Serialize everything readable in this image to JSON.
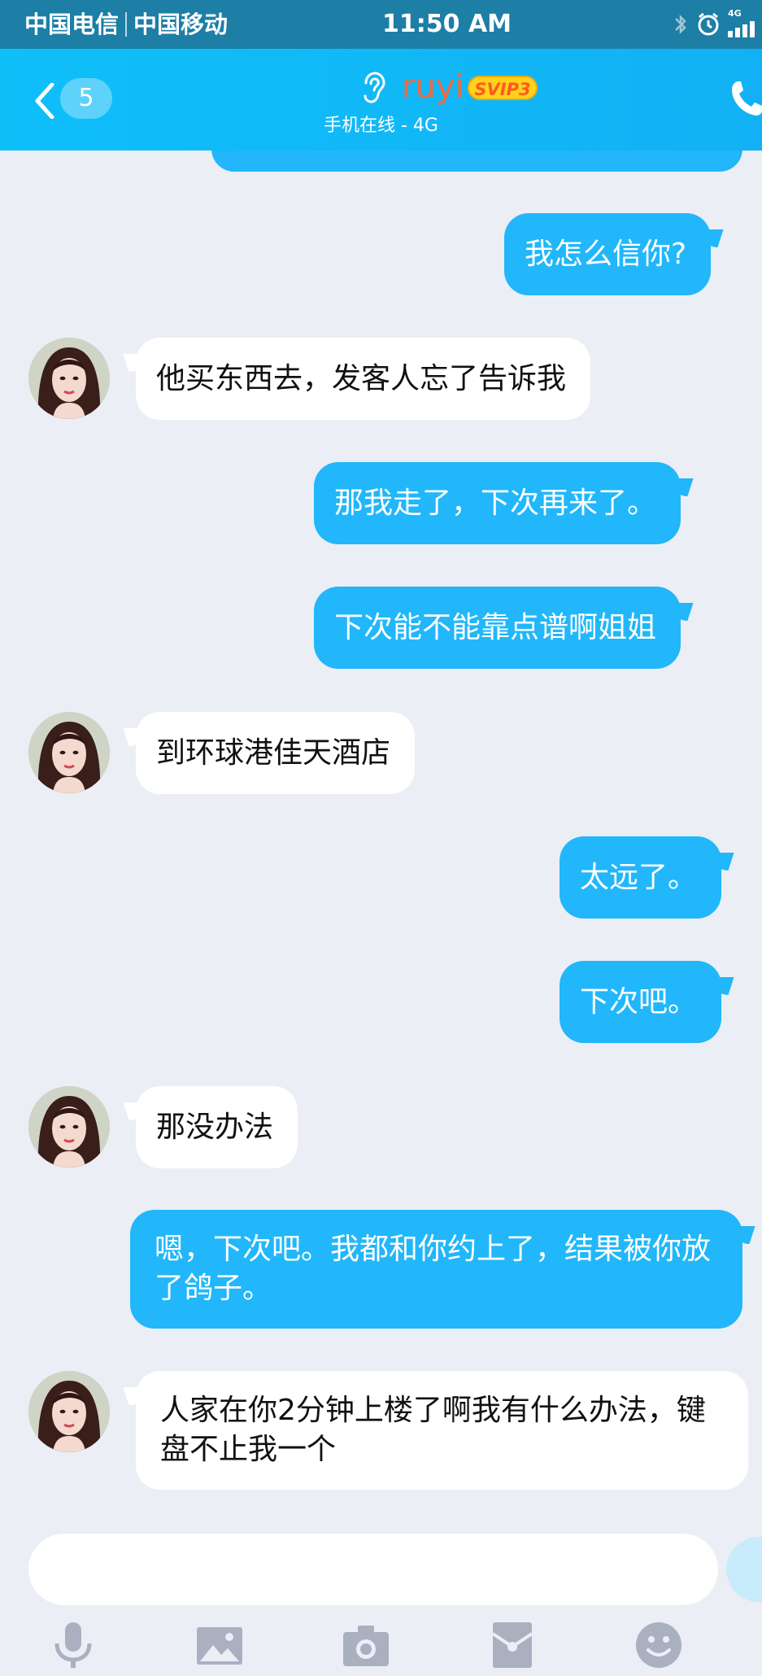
{
  "status_bar": {
    "carrier1": "中国电信",
    "carrier2": "中国移动",
    "time": "11:50 AM",
    "network": "4G",
    "icons": [
      "bluetooth-icon",
      "alarm-icon",
      "signal-icon"
    ]
  },
  "header": {
    "back_count": "5",
    "contact_name": "ruyi",
    "vip_badge": "SVIP3",
    "status": "手机在线 - 4G",
    "icons": [
      "back-chevron-icon",
      "ear-icon",
      "phone-icon"
    ]
  },
  "messages": [
    {
      "dir": "out",
      "text": "我怎么信你?"
    },
    {
      "dir": "in",
      "text": "他买东西去，发客人忘了告诉我"
    },
    {
      "dir": "out",
      "text": "那我走了，下次再来了。"
    },
    {
      "dir": "out",
      "text": "下次能不能靠点谱啊姐姐"
    },
    {
      "dir": "in",
      "text": "到环球港佳天酒店"
    },
    {
      "dir": "out",
      "text": "太远了。"
    },
    {
      "dir": "out",
      "text": "下次吧。"
    },
    {
      "dir": "in",
      "text": "那没办法"
    },
    {
      "dir": "out",
      "text": "嗯，下次吧。我都和你约上了，结果被你放了鸽子。"
    },
    {
      "dir": "in",
      "text": "人家在你2分钟上楼了啊我有什么办法，键盘不止我一个"
    }
  ],
  "input": {
    "value": "",
    "placeholder": ""
  },
  "toolbar": [
    "microphone-icon",
    "image-icon",
    "camera-icon",
    "red-packet-icon",
    "emoji-icon"
  ],
  "colors": {
    "status_bar": "#1d7ea6",
    "header": "#12b8f7",
    "outgoing_bubble": "#21b7fa",
    "incoming_bubble": "#ffffff",
    "background": "#eceef5",
    "name": "#f06a41",
    "vip_badge": "#ffd21e"
  }
}
